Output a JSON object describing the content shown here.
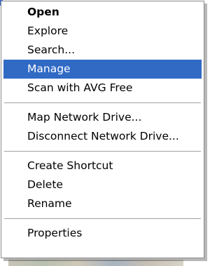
{
  "context_menu": {
    "groups": [
      {
        "items": [
          {
            "label": "Open",
            "bold": true,
            "selected": false
          },
          {
            "label": "Explore",
            "bold": false,
            "selected": false
          },
          {
            "label": "Search...",
            "bold": false,
            "selected": false
          },
          {
            "label": "Manage",
            "bold": false,
            "selected": true
          },
          {
            "label": "Scan with AVG Free",
            "bold": false,
            "selected": false
          }
        ]
      },
      {
        "items": [
          {
            "label": "Map Network Drive...",
            "bold": false,
            "selected": false
          },
          {
            "label": "Disconnect Network Drive...",
            "bold": false,
            "selected": false
          }
        ]
      },
      {
        "items": [
          {
            "label": "Create Shortcut",
            "bold": false,
            "selected": false
          },
          {
            "label": "Delete",
            "bold": false,
            "selected": false
          },
          {
            "label": "Rename",
            "bold": false,
            "selected": false
          }
        ]
      },
      {
        "items": [
          {
            "label": "Properties",
            "bold": false,
            "selected": false
          }
        ]
      }
    ]
  },
  "colors": {
    "selection_background": "#316ac5",
    "selection_text": "#ffffff",
    "menu_background": "#ffffff",
    "separator": "#a0a0a0"
  }
}
